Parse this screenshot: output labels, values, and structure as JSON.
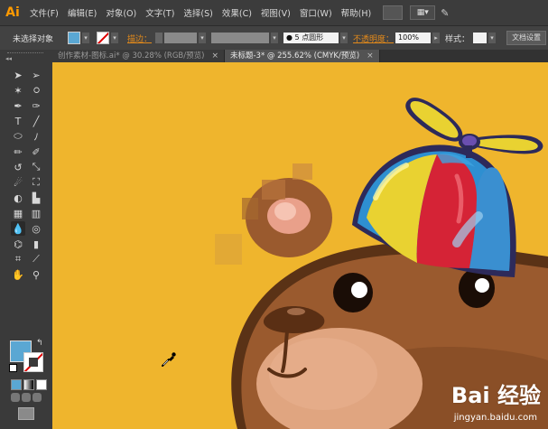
{
  "app": {
    "logo": "Ai",
    "brand_color": "#ff9a00"
  },
  "menu": [
    "文件(F)",
    "编辑(E)",
    "对象(O)",
    "文字(T)",
    "选择(S)",
    "效果(C)",
    "视图(V)",
    "窗口(W)",
    "帮助(H)"
  ],
  "control_bar": {
    "selection_label": "未选择对象",
    "fill_color": "#5aa7d3",
    "stroke_label": "描边：",
    "brush_value": "● 5 点圆形",
    "opacity_label": "不透明度：",
    "opacity_value": "100%",
    "style_label": "样式：",
    "doc_settings_label": "文档设置"
  },
  "tabs": [
    {
      "label": "创作素材-图标.ai* @ 30.28% (RGB/预览)",
      "close": "×",
      "active": false
    },
    {
      "label": "未标题-3* @ 255.62% (CMYK/预览)",
      "close": "×",
      "active": true
    }
  ],
  "toolbox": {
    "tools": [
      "selection",
      "direct-selection",
      "magic-wand",
      "lasso",
      "pen",
      "curvature",
      "type",
      "line-segment",
      "ellipse",
      "paintbrush",
      "pencil",
      "blob-brush",
      "rotate",
      "scale",
      "warp",
      "free-transform",
      "shape-builder",
      "perspective-grid",
      "mesh",
      "gradient",
      "eyedropper",
      "blend",
      "symbol-sprayer",
      "column-graph",
      "artboard",
      "slice",
      "hand",
      "zoom"
    ],
    "active_tool": "eyedropper",
    "fill_color": "#5aa7d3",
    "stroke_color": "none"
  },
  "canvas": {
    "background_color": "#efb52d",
    "watermark": {
      "logo": "Bai 经验",
      "url": "jingyan.baidu.com"
    }
  }
}
